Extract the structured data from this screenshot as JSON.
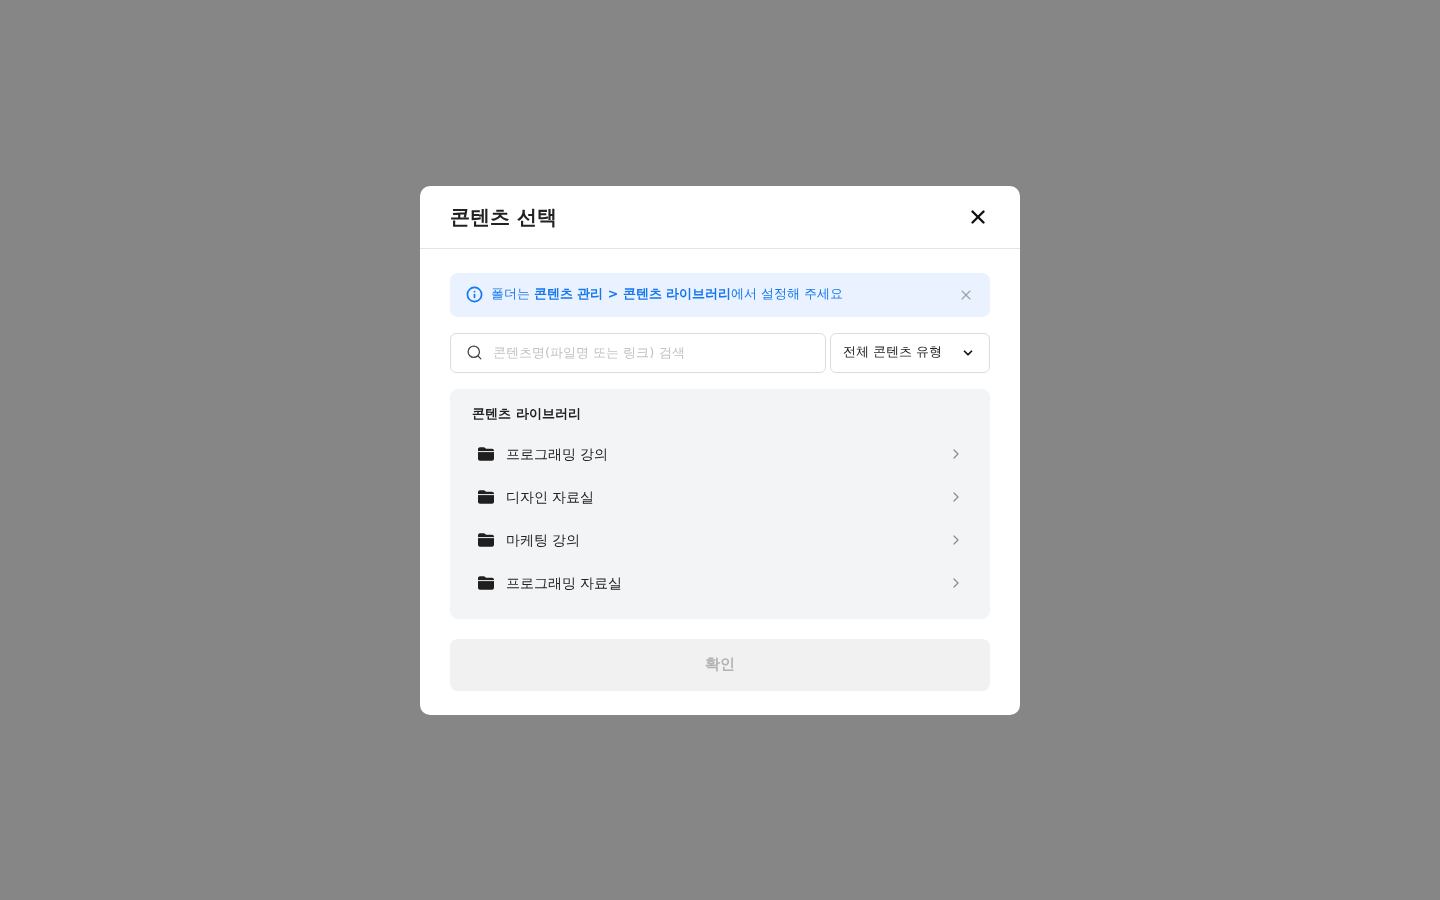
{
  "dialog": {
    "title": "콘텐츠 선택"
  },
  "notice": {
    "text": "폴더는 **콘텐츠 관리 > 콘텐츠 라이브러리**에서 설정해 주세요"
  },
  "search": {
    "placeholder": "콘텐츠명(파일명 또는 링크) 검색"
  },
  "type_filter": {
    "value": "전체 콘텐츠 유형"
  },
  "library": {
    "title": "콘텐츠 라이브러리",
    "folders": [
      {
        "name": "프로그래밍 강의"
      },
      {
        "name": "디자인 자료실"
      },
      {
        "name": "마케팅 강의"
      },
      {
        "name": "프로그래밍 자료실"
      }
    ]
  },
  "confirm_button": {
    "label": "확인",
    "disabled": true
  }
}
